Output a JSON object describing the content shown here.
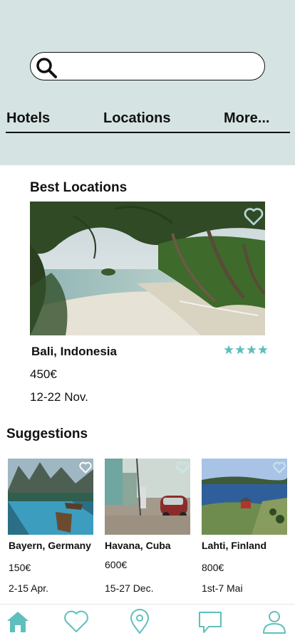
{
  "search": {
    "placeholder": "",
    "value": ""
  },
  "nav": {
    "tabs": [
      "Hotels",
      "Locations",
      "More..."
    ]
  },
  "best_locations": {
    "title": "Best Locations",
    "name": "Bali, Indonesia",
    "price": "450€",
    "dates": "12-22 Nov.",
    "rating": 4,
    "rating_max": 4
  },
  "suggestions": {
    "title": "Suggestions",
    "items": [
      {
        "name": "Bayern, Germany",
        "price": "150€",
        "dates": "2-15 Apr."
      },
      {
        "name": "Havana, Cuba",
        "price": "600€",
        "dates": "15-27 Dec."
      },
      {
        "name": "Lahti, Finland",
        "price": "800€",
        "dates": "1st-7 Mai"
      }
    ]
  },
  "bottom_nav": [
    "home-icon",
    "heart-icon",
    "location-pin-icon",
    "chat-icon",
    "user-icon"
  ],
  "colors": {
    "accent": "#5fbfbd",
    "header_bg": "#d5e4e2"
  }
}
